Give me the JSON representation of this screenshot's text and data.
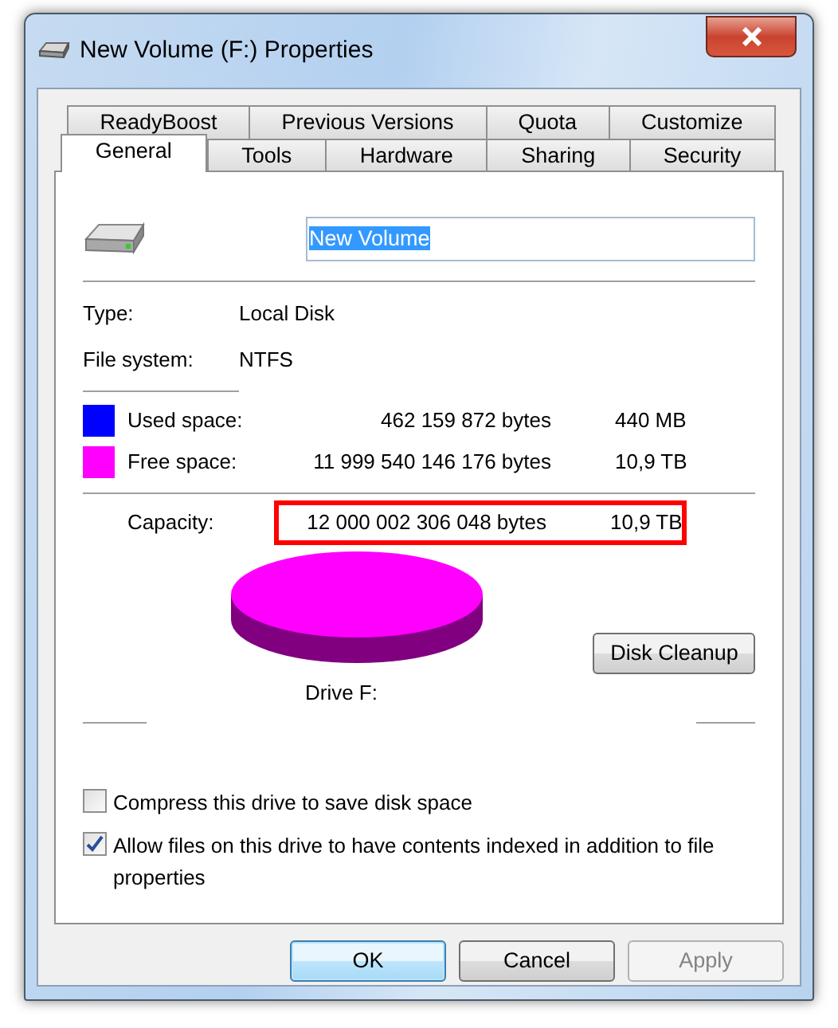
{
  "window": {
    "title": "New Volume (F:) Properties"
  },
  "tab_rows": [
    {
      "tabs": [
        {
          "label": "ReadyBoost",
          "selected": false
        },
        {
          "label": "Previous Versions",
          "selected": false
        },
        {
          "label": "Quota",
          "selected": false
        },
        {
          "label": "Customize",
          "selected": false
        }
      ]
    },
    {
      "tabs": [
        {
          "label": "General",
          "selected": true
        },
        {
          "label": "Tools",
          "selected": false
        },
        {
          "label": "Hardware",
          "selected": false
        },
        {
          "label": "Sharing",
          "selected": false
        },
        {
          "label": "Security",
          "selected": false
        }
      ]
    }
  ],
  "volume_name": {
    "value": "New Volume",
    "text_selected": true
  },
  "info": [
    {
      "label": "Type:",
      "value": "Local Disk"
    },
    {
      "label": "File system:",
      "value": "NTFS"
    }
  ],
  "space": [
    {
      "label": "Used space:",
      "color": "#0000ff",
      "bytes": "462 159 872 bytes",
      "size": "440 MB"
    },
    {
      "label": "Free space:",
      "color": "#ff00ff",
      "bytes": "11 999 540 146 176 bytes",
      "size": "10,9 TB"
    }
  ],
  "capacity": {
    "label": "Capacity:",
    "bytes": "12 000 002 306 048 bytes",
    "size": "10,9 TB",
    "outlined": true
  },
  "drive_label": "Drive F:",
  "disk_cleanup": "Disk Cleanup",
  "options": [
    {
      "label": "Compress this drive to save disk space",
      "checked": false
    },
    {
      "label": "Allow files on this drive to have contents indexed in addition to file properties",
      "checked": true
    }
  ],
  "buttons": [
    {
      "label": "OK",
      "default": true,
      "disabled": false
    },
    {
      "label": "Cancel",
      "default": false,
      "disabled": false
    },
    {
      "label": "Apply",
      "default": false,
      "disabled": true
    }
  ]
}
